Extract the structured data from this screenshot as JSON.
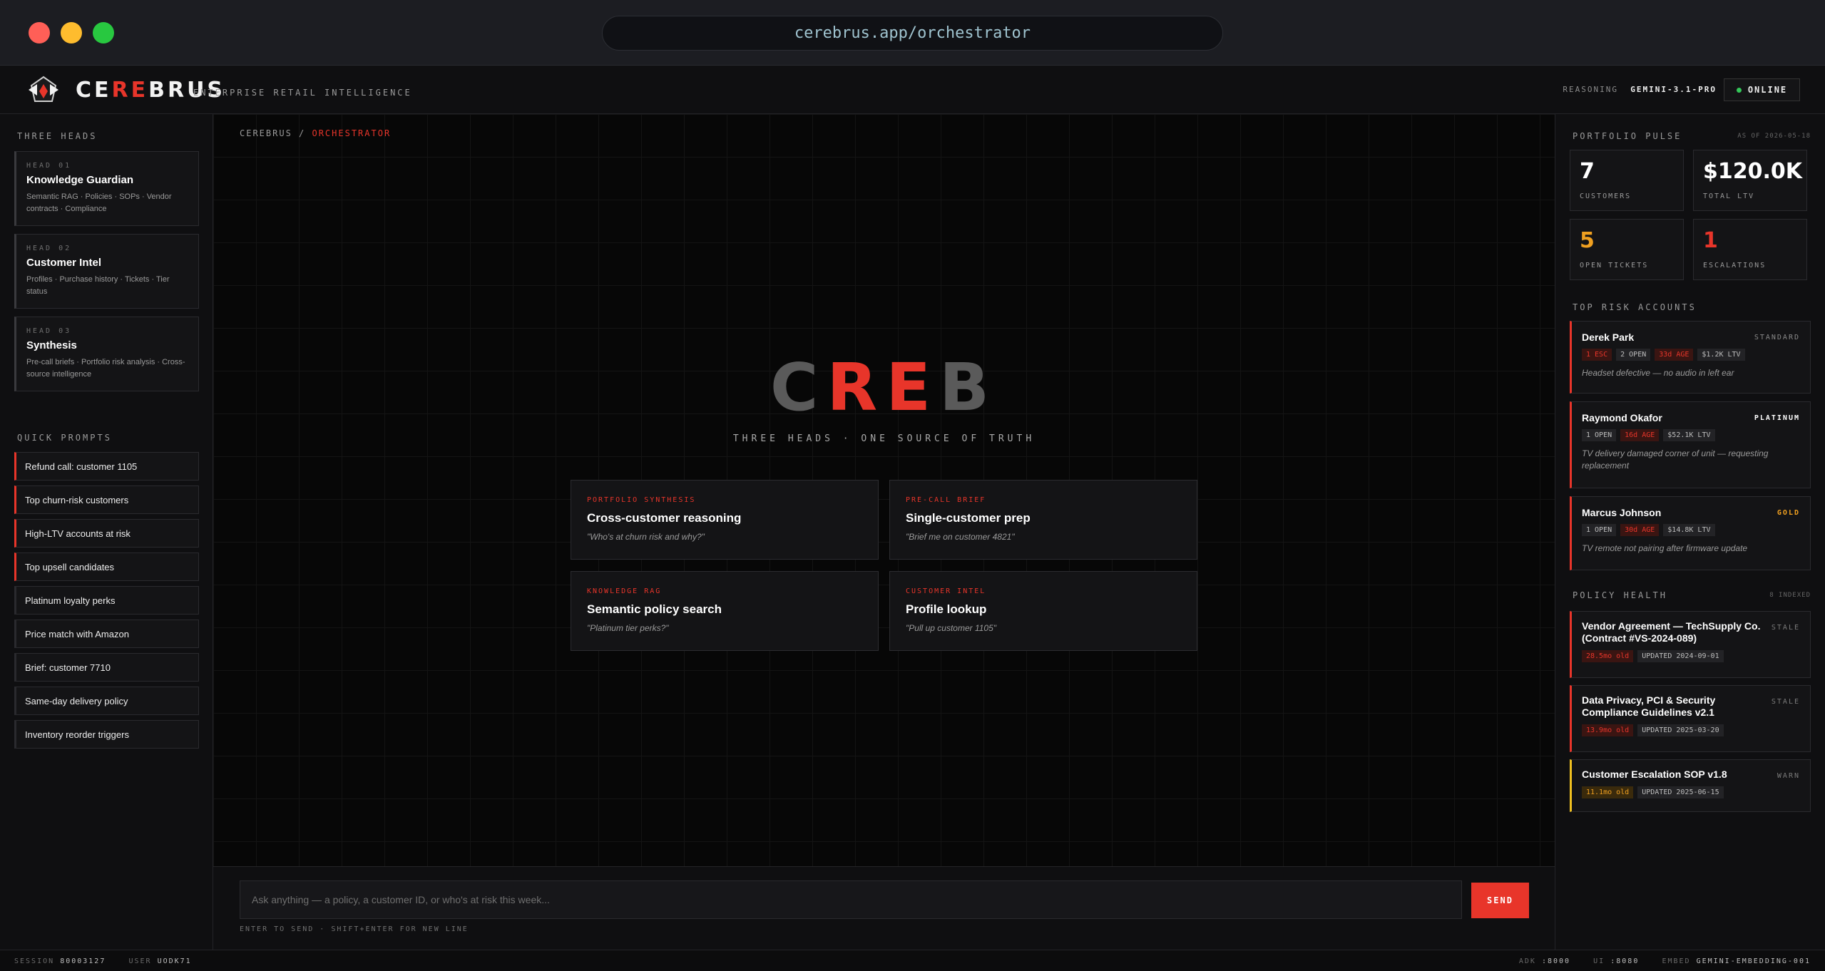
{
  "browser": {
    "url": "cerebrus.app/orchestrator"
  },
  "header": {
    "brand_a": "CE",
    "brand_b": "RE",
    "brand_c": "BRUS",
    "subtitle": "ENTERPRISE RETAIL INTELLIGENCE",
    "reasoning_label": "REASONING",
    "reasoning_model": "GEMINI-3.1-PRO",
    "status": "ONLINE"
  },
  "left": {
    "heads_title": "THREE HEADS",
    "heads": [
      {
        "tag": "HEAD 01",
        "name": "Knowledge Guardian",
        "desc": "Semantic RAG · Policies · SOPs · Vendor contracts · Compliance"
      },
      {
        "tag": "HEAD 02",
        "name": "Customer Intel",
        "desc": "Profiles · Purchase history · Tickets · Tier status"
      },
      {
        "tag": "HEAD 03",
        "name": "Synthesis",
        "desc": "Pre-call briefs · Portfolio risk analysis · Cross-source intelligence"
      }
    ],
    "prompts_title": "QUICK PROMPTS",
    "prompts": [
      "Refund call: customer 1105",
      "Top churn-risk customers",
      "High-LTV accounts at risk",
      "Top upsell candidates",
      "Platinum loyalty perks",
      "Price match with Amazon",
      "Brief: customer 7710",
      "Same-day delivery policy",
      "Inventory reorder triggers"
    ]
  },
  "main": {
    "crumb_root": "CEREBRUS /",
    "crumb_current": "ORCHESTRATOR",
    "hero_a": "C",
    "hero_b": "RE",
    "hero_c": "B",
    "hero_sub": "THREE HEADS · ONE SOURCE OF TRUTH",
    "features": [
      {
        "cat": "PORTFOLIO SYNTHESIS",
        "title": "Cross-customer reasoning",
        "example": "\"Who's at churn risk and why?\""
      },
      {
        "cat": "PRE-CALL BRIEF",
        "title": "Single-customer prep",
        "example": "\"Brief me on customer 4821\""
      },
      {
        "cat": "KNOWLEDGE RAG",
        "title": "Semantic policy search",
        "example": "\"Platinum tier perks?\""
      },
      {
        "cat": "CUSTOMER INTEL",
        "title": "Profile lookup",
        "example": "\"Pull up customer 1105\""
      }
    ],
    "input_placeholder": "Ask anything — a policy, a customer ID, or who's at risk this week...",
    "send_label": "SEND",
    "hint": "ENTER TO SEND · SHIFT+ENTER FOR NEW LINE"
  },
  "right": {
    "pulse_title": "PORTFOLIO PULSE",
    "as_of": "AS OF 2026-05-18",
    "kpis": [
      {
        "value": "7",
        "label": "CUSTOMERS",
        "color": "#ffffff"
      },
      {
        "value": "$120.0K",
        "label": "TOTAL LTV",
        "color": "#ffffff"
      },
      {
        "value": "5",
        "label": "OPEN TICKETS",
        "color": "#f0a020"
      },
      {
        "value": "1",
        "label": "ESCALATIONS",
        "color": "#e8352a"
      }
    ],
    "risk_title": "TOP RISK ACCOUNTS",
    "accounts": [
      {
        "name": "Derek Park",
        "tier": "STANDARD",
        "tier_color": "#8a8a8a",
        "chips": [
          "1 ESC",
          "2 OPEN",
          "33d AGE",
          "$1.2K LTV"
        ],
        "note": "Headset defective — no audio in left ear"
      },
      {
        "name": "Raymond Okafor",
        "tier": "PLATINUM",
        "tier_color": "#ffffff",
        "chips": [
          "1 OPEN",
          "16d AGE",
          "$52.1K LTV"
        ],
        "note": "TV delivery damaged corner of unit — requesting replacement"
      },
      {
        "name": "Marcus Johnson",
        "tier": "GOLD",
        "tier_color": "#f0a020",
        "chips": [
          "1 OPEN",
          "30d AGE",
          "$14.8K LTV"
        ],
        "note": "TV remote not pairing after firmware update"
      }
    ],
    "policy_title": "POLICY HEALTH",
    "policy_count": "8 INDEXED",
    "policies": [
      {
        "name": "Vendor Agreement — TechSupply Co. (Contract #VS-2024-089)",
        "status": "STALE",
        "age": "28.5mo old",
        "updated": "UPDATED 2024-09-01"
      },
      {
        "name": "Data Privacy, PCI & Security Compliance Guidelines v2.1",
        "status": "STALE",
        "age": "13.9mo old",
        "updated": "UPDATED 2025-03-20"
      },
      {
        "name": "Customer Escalation SOP v1.8",
        "status": "WARN",
        "age": "11.1mo old",
        "updated": "UPDATED 2025-06-15"
      }
    ]
  },
  "status_bar": {
    "session_label": "SESSION",
    "session": "80003127",
    "user_label": "USER",
    "user": "UODK71",
    "adk_label": "ADK",
    "adk": ":8000",
    "ui_label": "UI",
    "ui": ":8080",
    "embed_label": "EMBED",
    "embed": "GEMINI-EMBEDDING-001"
  }
}
